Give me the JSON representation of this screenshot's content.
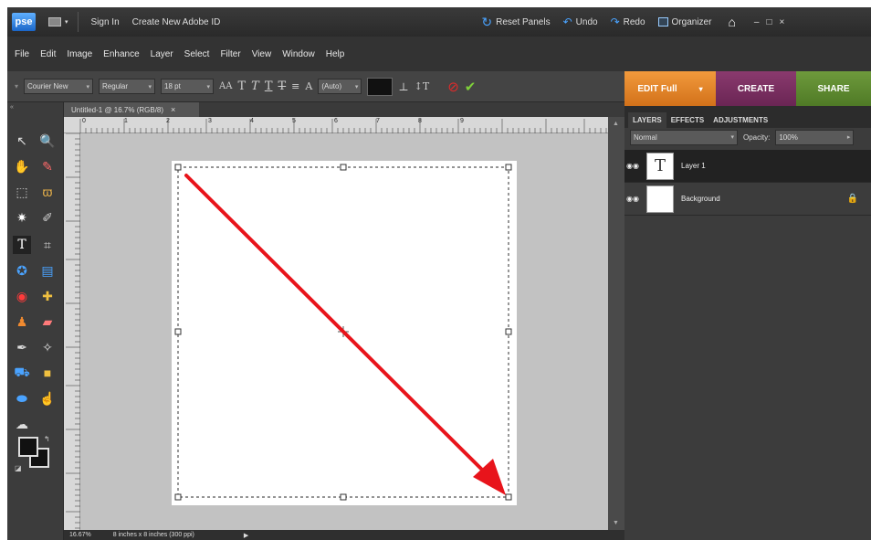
{
  "topbar": {
    "logo": "pse",
    "sign_in": "Sign In",
    "create_id": "Create New Adobe ID",
    "reset_panels": "Reset Panels",
    "undo": "Undo",
    "redo": "Redo",
    "organizer": "Organizer"
  },
  "menu": [
    "File",
    "Edit",
    "Image",
    "Enhance",
    "Layer",
    "Select",
    "Filter",
    "View",
    "Window",
    "Help"
  ],
  "options": {
    "font_family": "Courier New",
    "font_style": "Regular",
    "font_size": "18 pt",
    "leading": "(Auto)"
  },
  "mode_tabs": {
    "edit": "EDIT Full",
    "create": "CREATE",
    "share": "SHARE"
  },
  "document": {
    "tab_title": "Untitled-1 @ 16.7% (RGB/8)",
    "zoom": "16.67%",
    "doc_info": "8 inches x 8 inches (300 ppi)",
    "ruler_top": [
      "0",
      "1",
      "2",
      "3",
      "4",
      "5",
      "6",
      "7",
      "8",
      "9"
    ]
  },
  "panel": {
    "tabs": [
      "LAYERS",
      "EFFECTS",
      "ADJUSTMENTS"
    ],
    "blend_mode": "Normal",
    "opacity_label": "Opacity:",
    "opacity_value": "100%",
    "layers": [
      {
        "name": "Layer 1",
        "thumb": "T"
      },
      {
        "name": "Background",
        "thumb": ""
      }
    ]
  },
  "colors": {
    "accent_edit": "#e0821f",
    "accent_create": "#7a2f62",
    "accent_share": "#5f8a30",
    "arrow": "#e8141b"
  }
}
